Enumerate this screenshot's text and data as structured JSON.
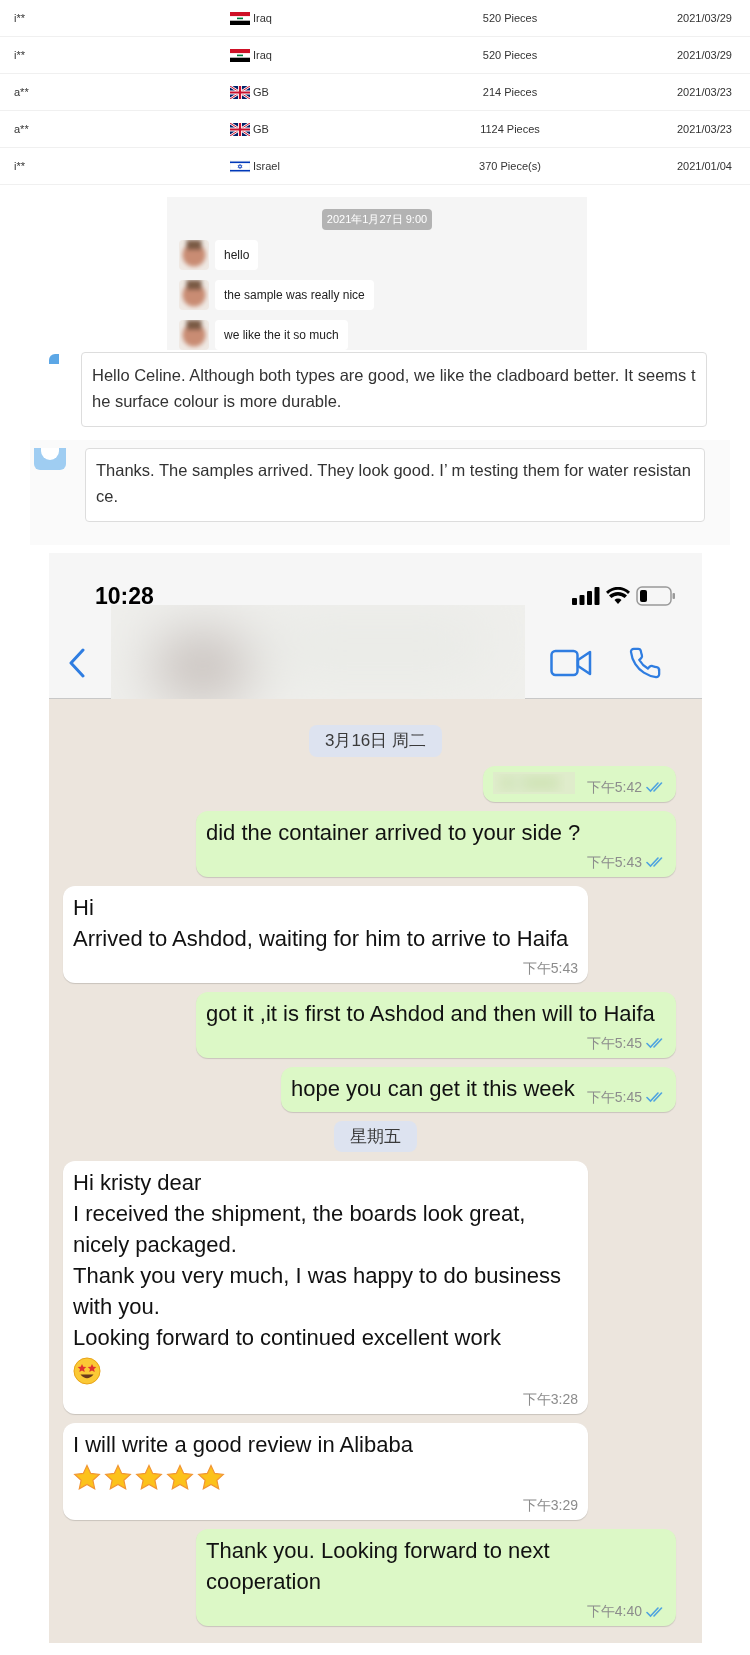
{
  "orders_table": {
    "rows": [
      {
        "buyer": "i**",
        "kind": "iraq",
        "country": "Iraq",
        "quantity": "520 Pieces",
        "date": "2021/03/29"
      },
      {
        "buyer": "i**",
        "kind": "iraq",
        "country": "Iraq",
        "quantity": "520 Pieces",
        "date": "2021/03/29"
      },
      {
        "buyer": "a**",
        "kind": "gb",
        "country": "GB",
        "quantity": "214 Pieces",
        "date": "2021/03/23"
      },
      {
        "buyer": "a**",
        "kind": "gb",
        "country": "GB",
        "quantity": "1124 Pieces",
        "date": "2021/03/23"
      },
      {
        "buyer": "i**",
        "kind": "israel",
        "country": "Israel",
        "quantity": "370 Piece(s)",
        "date": "2021/01/04"
      }
    ]
  },
  "chat_snippet": {
    "timestamp": "2021年1月27日 9:00",
    "messages": [
      "hello",
      "the sample was really nice",
      "we like the it so much"
    ]
  },
  "comments": [
    {
      "text": "Hello Celine. Although both types are good, we like the cladboard better. It seems the surface colour is more durable."
    },
    {
      "text": "Thanks. The samples arrived. They look good. I’ m testing them for water resistance."
    }
  ],
  "phone": {
    "status_bar": {
      "time": "10:28"
    },
    "messages": [
      {
        "kind": "date",
        "text": "3月16日 周二"
      },
      {
        "kind": "outgoing",
        "blurred": true,
        "time": "下午5:42",
        "read": true
      },
      {
        "kind": "outgoing",
        "text": "did the container arrived to your side ?",
        "time": "下午5:43",
        "read": true
      },
      {
        "kind": "incoming",
        "text": "Hi\nArrived to Ashdod, waiting for him to arrive to Haifa",
        "time": "下午5:43"
      },
      {
        "kind": "outgoing",
        "text": "got it ,it is first to Ashdod and then will to Haifa",
        "time": "下午5:45",
        "read": true
      },
      {
        "kind": "outgoing",
        "text": "hope you can get it this week",
        "time": "下午5:45",
        "read": true
      },
      {
        "kind": "date",
        "text": "星期五"
      },
      {
        "kind": "incoming",
        "text": "Hi kristy dear\nI received the shipment, the boards look great, nicely packaged.\nThank you very much, I was happy to do business with you.\nLooking forward to continued excellent work",
        "emoji": true,
        "time": "下午3:28"
      },
      {
        "kind": "incoming",
        "text": "I will write a good review in Alibaba",
        "stars": 5,
        "time": "下午3:29"
      },
      {
        "kind": "outgoing",
        "text": "Thank you. Looking forward to next cooperation",
        "time": "下午4:40",
        "read": true
      }
    ]
  }
}
